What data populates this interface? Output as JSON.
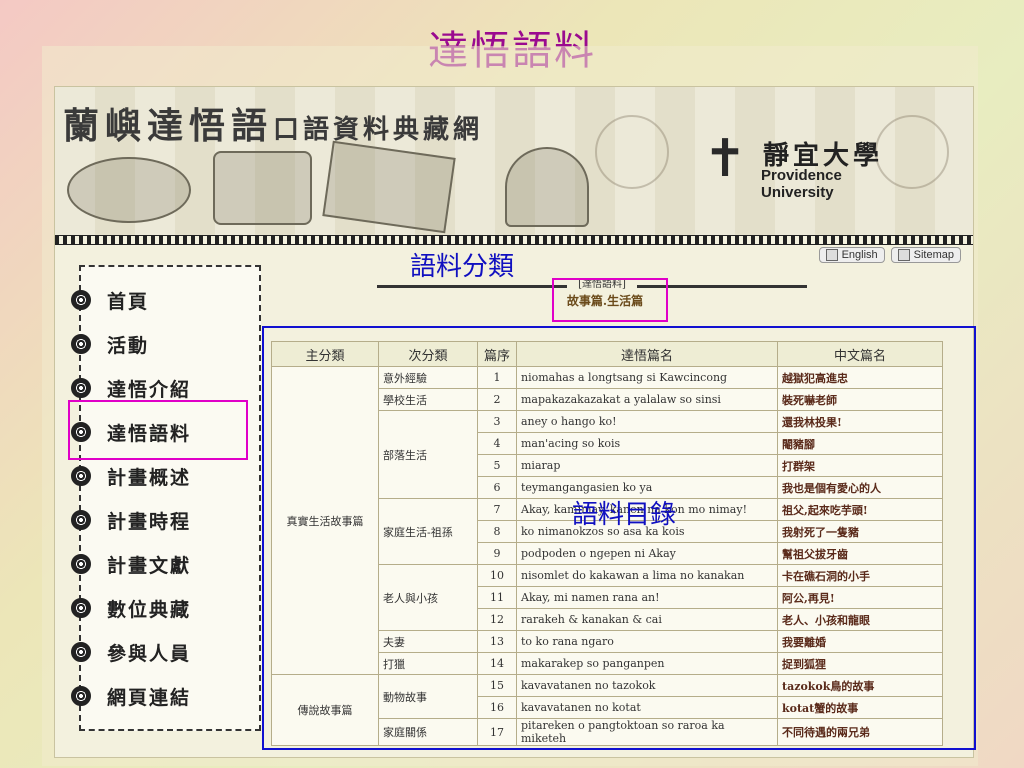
{
  "slide": {
    "title": "達悟語料"
  },
  "site": {
    "banner_title": "蘭嶼達悟語",
    "banner_title_small": "口語資料典藏網",
    "university_zh": "靜宜大學",
    "university_en": "Providence University"
  },
  "lang_bar": {
    "english": "English",
    "sitemap": "Sitemap"
  },
  "nav": [
    "首頁",
    "活動",
    "達悟介紹",
    "達悟語料",
    "計畫概述",
    "計畫時程",
    "計畫文獻",
    "數位典藏",
    "參與人員",
    "網頁連結"
  ],
  "category_bar": {
    "heading": "[達悟語料]",
    "subcategories": "故事篇.生活篇"
  },
  "callouts": {
    "category_label": "語料分類",
    "catalog_label": "語料目錄"
  },
  "table": {
    "headers": [
      "主分類",
      "次分類",
      "篇序",
      "達悟篇名",
      "中文篇名"
    ],
    "groups": [
      {
        "main": "真實生活故事篇",
        "subgroups": [
          {
            "sub": "意外經驗",
            "rows": [
              [
                "1",
                "niomahas a longtsang si Kawcincong",
                "越獄犯高進忠"
              ]
            ]
          },
          {
            "sub": "學校生活",
            "rows": [
              [
                "2",
                "mapakazakazakat a yalalaw so sinsi",
                "裝死嚇老師"
              ]
            ]
          },
          {
            "sub": "部落生活",
            "rows": [
              [
                "3",
                "aney o hango ko!",
                "還我林投果!"
              ],
              [
                "4",
                "man'acing so kois",
                "閹豬腳"
              ],
              [
                "5",
                "miarap",
                "打群架"
              ],
              [
                "6",
                "teymangangasien ko ya",
                "我也是個有愛心的人"
              ]
            ]
          },
          {
            "sub": "家庭生活-祖孫",
            "rows": [
              [
                "7",
                "Akay, kamimay, kanen na kon mo nimay!",
                "祖父,起來吃芋頭!"
              ],
              [
                "8",
                "ko nimanokzos so asa ka kois",
                "我射死了一隻豬"
              ],
              [
                "9",
                "podpoden o ngepen ni Akay",
                "幫祖父拔牙齒"
              ]
            ]
          },
          {
            "sub": "老人與小孩",
            "rows": [
              [
                "10",
                "nisomlet do kakawan a lima no kanakan",
                "卡在礁石洞的小手"
              ],
              [
                "11",
                "Akay, mi namen rana an!",
                "阿公,再見!"
              ],
              [
                "12",
                "rarakeh & kanakan & cai",
                "老人、小孩和龍眼"
              ]
            ]
          },
          {
            "sub": "夫妻",
            "rows": [
              [
                "13",
                "to ko rana ngaro",
                "我要離婚"
              ]
            ]
          },
          {
            "sub": "打獵",
            "rows": [
              [
                "14",
                "makarakep so panganpen",
                "捉到狐狸"
              ]
            ]
          }
        ]
      },
      {
        "main": "傳說故事篇",
        "subgroups": [
          {
            "sub": "動物故事",
            "rows": [
              [
                "15",
                "kavavatanen no tazokok",
                "tazokok鳥的故事"
              ],
              [
                "16",
                "kavavatanen no kotat",
                "kotat蟹的故事"
              ]
            ]
          },
          {
            "sub": "家庭關係",
            "rows": [
              [
                "17",
                "pitareken o pangtoktoan so raroa ka miketeh",
                "不同待遇的兩兄弟"
              ]
            ]
          }
        ]
      }
    ]
  }
}
